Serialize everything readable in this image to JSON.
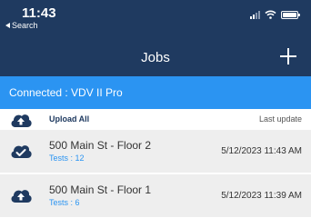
{
  "status_bar": {
    "time": "11:43",
    "back_label": "Search"
  },
  "nav": {
    "title": "Jobs",
    "add_icon": "plus-icon"
  },
  "connection": {
    "text": "Connected : VDV II Pro"
  },
  "upload": {
    "label": "Upload All",
    "last_update_label": "Last update",
    "icon": "cloud-upload-icon"
  },
  "jobs": [
    {
      "title": "500 Main St - Floor 2",
      "tests": "Tests : 12",
      "date": "5/12/2023 11:43 AM",
      "icon": "cloud-check-icon"
    },
    {
      "title": "500 Main St - Floor 1",
      "tests": "Tests : 6",
      "date": "5/12/2023 11:39 AM",
      "icon": "cloud-upload-icon"
    }
  ],
  "colors": {
    "nav": "#1f3a60",
    "accent": "#2b94f2",
    "row": "#eeeeee"
  }
}
